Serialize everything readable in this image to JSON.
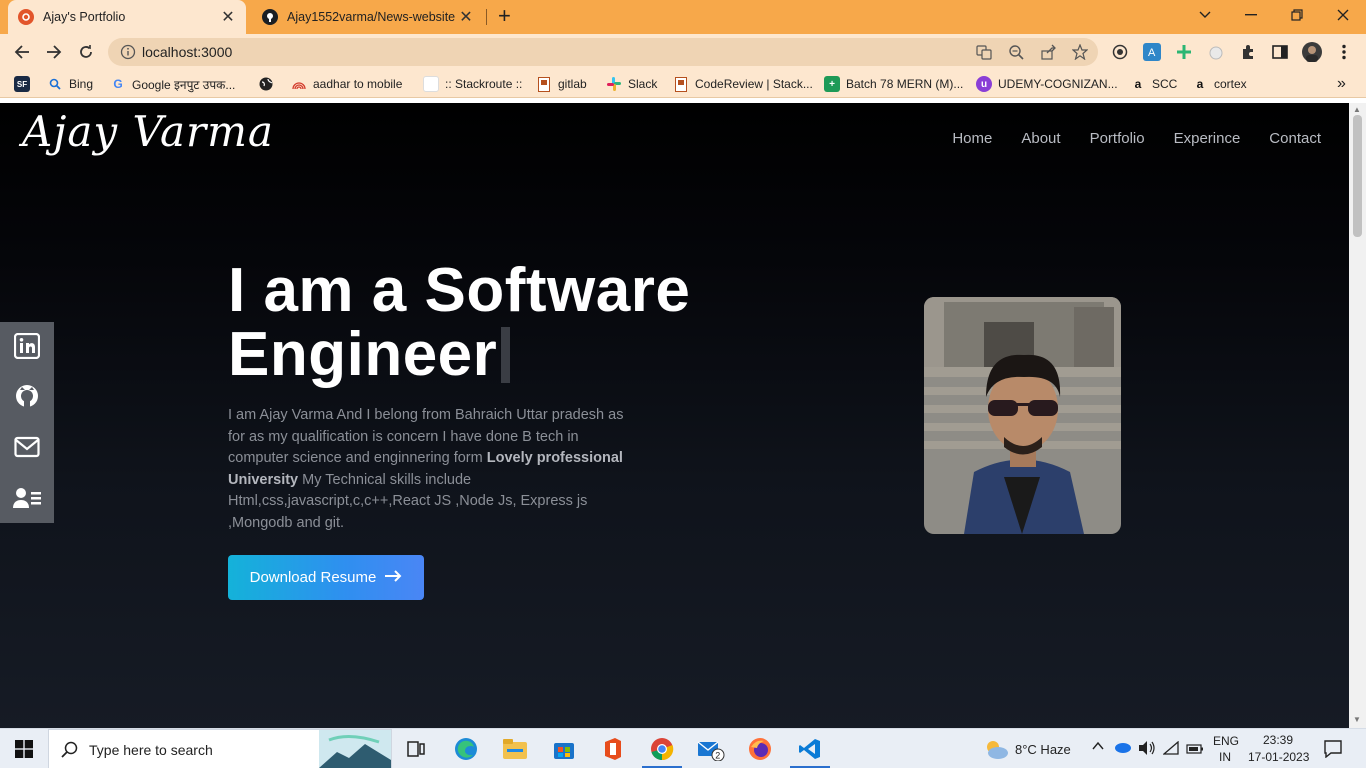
{
  "browser": {
    "tabs": [
      {
        "title": "Ajay's Portfolio",
        "active": true
      },
      {
        "title": "Ajay1552varma/News-website",
        "active": false
      }
    ],
    "url": "localhost:3000",
    "bookmarks": [
      {
        "label": "",
        "icon": "sf-icon"
      },
      {
        "label": "Bing",
        "icon": "bing-search-icon"
      },
      {
        "label": "Google इनपुट उपक...",
        "icon": "google-icon"
      },
      {
        "label": "",
        "icon": "globe-icon"
      },
      {
        "label": "aadhar to mobile",
        "icon": "aadhar-icon"
      },
      {
        "label": ":: Stackroute ::",
        "icon": "page-icon"
      },
      {
        "label": "gitlab",
        "icon": "bookmark-icon"
      },
      {
        "label": "Slack",
        "icon": "slack-icon"
      },
      {
        "label": "CodeReview | Stack...",
        "icon": "bookmark-icon"
      },
      {
        "label": "Batch 78 MERN (M)...",
        "icon": "sheets-icon"
      },
      {
        "label": "UDEMY-COGNIZAN...",
        "icon": "udemy-icon"
      },
      {
        "label": "SCC",
        "icon": "amazon-icon"
      },
      {
        "label": "cortex",
        "icon": "amazon-icon"
      }
    ],
    "more_label": "»"
  },
  "page": {
    "logo": "Ajay Varma",
    "nav": [
      "Home",
      "About",
      "Portfolio",
      "Experince",
      "Contact"
    ],
    "hero_line1": "I am a Software",
    "hero_line2": "Engineer",
    "desc_part1": "I am Ajay Varma And I belong from Bahraich Uttar pradesh as for as my qualification is concern I have done B tech in computer science and enginnering form ",
    "desc_bold": "Lovely professional University",
    "desc_part2": " My Technical skills include Html,css,javascript,c,c++,React JS ,Node Js, Express js ,Mongodb and git.",
    "resume_button": "Download Resume",
    "social": [
      "linkedin-icon",
      "github-icon",
      "mail-icon",
      "resume-icon"
    ]
  },
  "taskbar": {
    "search_placeholder": "Type here to search",
    "weather": "8°C  Haze",
    "lang1": "ENG",
    "lang2": "IN",
    "time": "23:39",
    "date": "17-01-2023",
    "mail_badge": "2"
  },
  "colors": {
    "tab_strip": "#f7a84a",
    "toolbar": "#fde7cf",
    "button_gradient_start": "#14b2d9",
    "button_gradient_end": "#4a86f5"
  }
}
